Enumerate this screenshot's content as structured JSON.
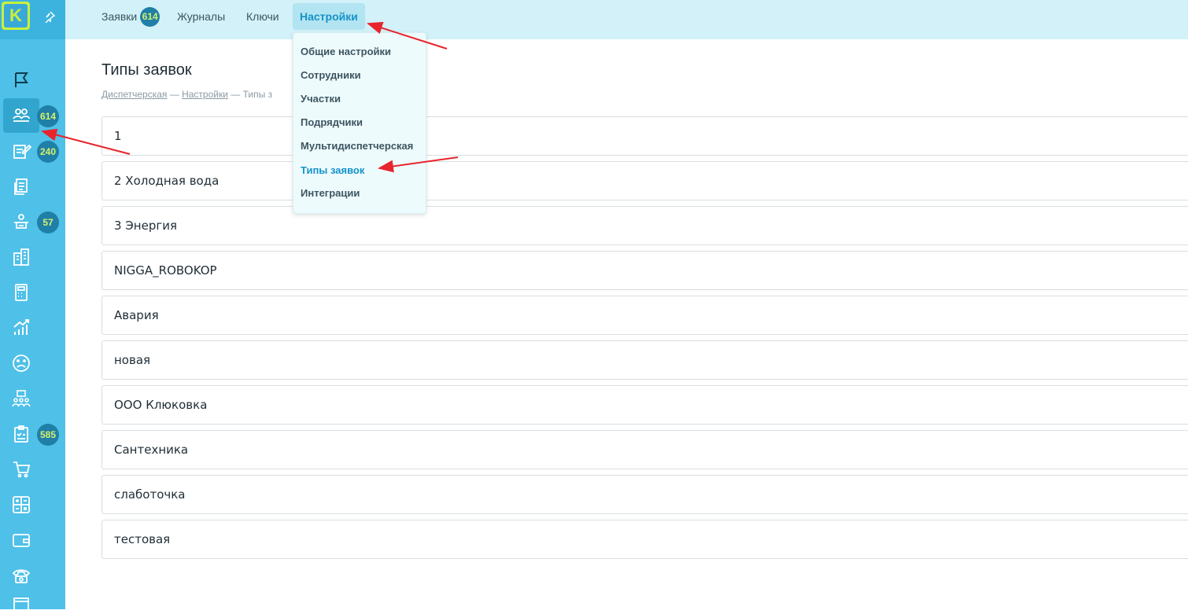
{
  "sidebar": {
    "logo_letter": "K",
    "items": [
      {
        "icon": "flag-icon",
        "badge": ""
      },
      {
        "icon": "requests-icon",
        "badge": "614"
      },
      {
        "icon": "edit-document-icon",
        "badge": "240"
      },
      {
        "icon": "documents-icon",
        "badge": ""
      },
      {
        "icon": "worker-icon",
        "badge": "57"
      },
      {
        "icon": "building-icon",
        "badge": ""
      },
      {
        "icon": "calculator-icon",
        "badge": ""
      },
      {
        "icon": "analytics-icon",
        "badge": ""
      },
      {
        "icon": "sad-face-icon",
        "badge": ""
      },
      {
        "icon": "team-icon",
        "badge": ""
      },
      {
        "icon": "checklist-icon",
        "badge": "585"
      },
      {
        "icon": "cart-icon",
        "badge": ""
      },
      {
        "icon": "calc-grid-icon",
        "badge": ""
      },
      {
        "icon": "wallet-icon",
        "badge": ""
      },
      {
        "icon": "phone-icon",
        "badge": ""
      }
    ]
  },
  "topnav": {
    "requests": "Заявки",
    "requests_badge": "614",
    "journals": "Журналы",
    "keys": "Ключи",
    "settings": "Настройки"
  },
  "dropdown": {
    "items": [
      "Общие настройки",
      "Сотрудники",
      "Участки",
      "Подрядчики",
      "Мультидиспетчерская",
      "Типы заявок",
      "Интеграции"
    ]
  },
  "page": {
    "title": "Типы заявок",
    "breadcrumb": [
      "Диспетчерская",
      "Настройки",
      "Типы з"
    ]
  },
  "list": [
    "1",
    "2 Холодная вода",
    "3 Энергия",
    "NIGGA_ROBOKOP",
    "Авария",
    "новая",
    "ООО Клюковка",
    "Сантехника",
    "слаботочка",
    "тестовая"
  ],
  "colors": {
    "accent": "#1593c9",
    "sidebar": "#4fc0e8",
    "badge": "#1f7fa6",
    "arrow": "#e8242c"
  }
}
